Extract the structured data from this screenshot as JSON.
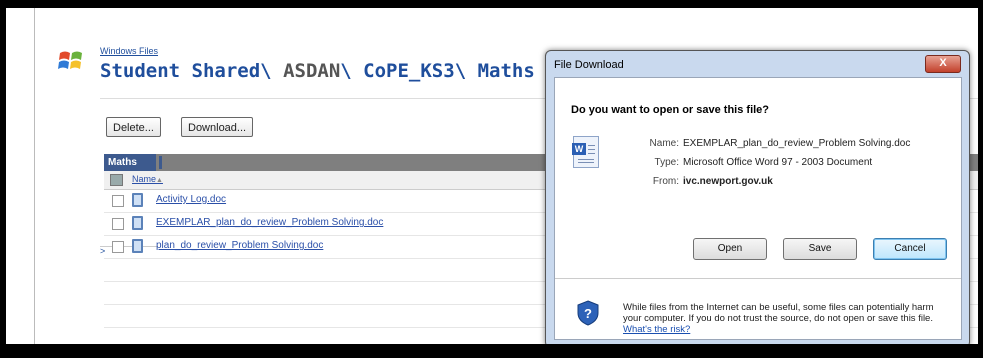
{
  "breadcrumb": {
    "root": "Windows Files",
    "arrow": ">"
  },
  "path": {
    "part1": "Student Shared",
    "part2": "ASDAN",
    "part3": "CoPE_KS3",
    "part4": "Maths",
    "sep": "\\"
  },
  "toolbar": {
    "delete_label": "Delete...",
    "download_label": "Download..."
  },
  "grid": {
    "tab_label": "Maths",
    "name_header": "Name",
    "sort_indicator": "▲",
    "files": [
      {
        "name": "Activity Log.doc"
      },
      {
        "name": "EXEMPLAR_plan_do_review_Problem Solving.doc"
      },
      {
        "name": "plan_do_review_Problem Solving.doc"
      }
    ]
  },
  "dialog": {
    "title": "File Download",
    "close_glyph": "X",
    "question": "Do you want to open or save this file?",
    "name_label": "Name:",
    "name_value": "EXEMPLAR_plan_do_review_Problem Solving.doc",
    "type_label": "Type:",
    "type_value": "Microsoft Office Word 97 - 2003 Document",
    "from_label": "From:",
    "from_value": "ivc.newport.gov.uk",
    "open_label": "Open",
    "save_label": "Save",
    "cancel_label": "Cancel",
    "warning_text": "While files from the Internet can be useful, some files can potentially harm your computer. If you do not trust the source, do not open or save this file.",
    "risk_link": "What's the risk?"
  },
  "icons": {
    "logo": "windows-logo-icon",
    "file": "word-document-icon",
    "shield": "security-shield-icon"
  }
}
